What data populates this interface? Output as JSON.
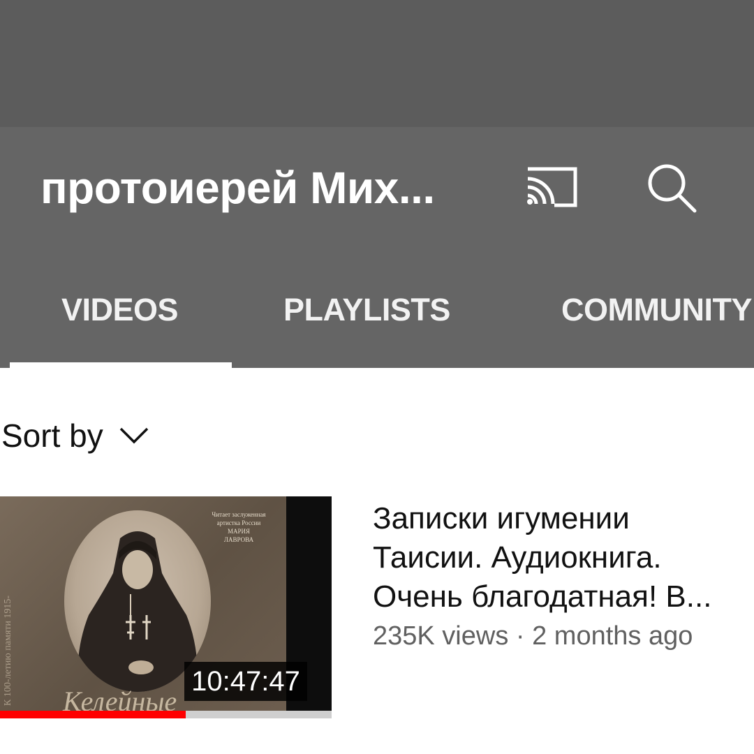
{
  "header": {
    "channel_title": "протоиерей Мих...",
    "icons": {
      "cast": "cast-icon",
      "search": "search-icon"
    }
  },
  "tabs": [
    {
      "label": "VIDEOS",
      "selected": true
    },
    {
      "label": "PLAYLISTS",
      "selected": false
    },
    {
      "label": "COMMUNITY",
      "selected": false
    }
  ],
  "sort": {
    "label": "Sort by",
    "icon": "chevron-down-icon"
  },
  "video": {
    "title_lines": [
      "Записки игумении",
      "Таисии. Аудиокнига.",
      "Очень благодатная! В..."
    ],
    "views": "235K views",
    "separator": "·",
    "age": "2 months ago",
    "duration": "10:47:47",
    "watch_progress": 0.56,
    "thumbnail": {
      "caption_lines": [
        "Читает заслуженная",
        "артистка России",
        "МАРИЯ",
        "ЛАВРОВА"
      ],
      "side_text": "К 100-летию памяти 1915-",
      "script_title": "Келейные"
    }
  },
  "colors": {
    "status_bar": "#5c5c5c",
    "app_bar": "#656565",
    "progress": "#ff0000",
    "meta_text": "#606060"
  }
}
